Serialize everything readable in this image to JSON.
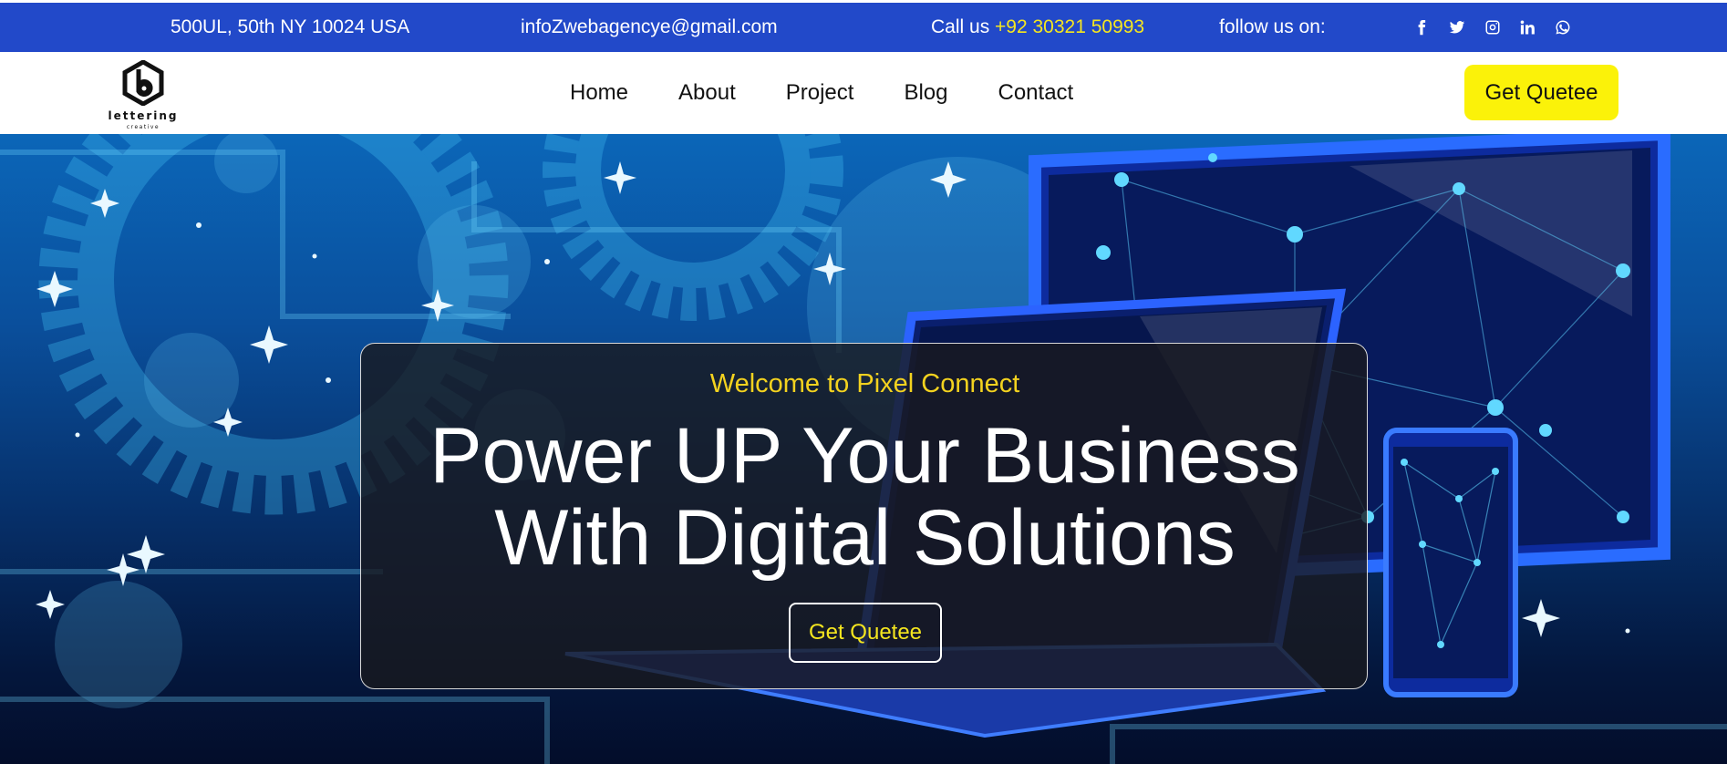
{
  "topbar": {
    "address": "500UL, 50th NY 10024 USA",
    "email": "infoZwebagencye@gmail.com",
    "call_label": "Call us ",
    "phone": "+92 30321 50993",
    "follow_label": "follow us on:",
    "social": [
      "facebook-icon",
      "twitter-icon",
      "instagram-icon",
      "linkedin-icon",
      "whatsapp-icon"
    ],
    "bg_color": "#2249c9",
    "phone_color": "#f5e61f"
  },
  "navbar": {
    "logo": {
      "word": "lettering",
      "sub": "creative",
      "mark": "hexagon-b-icon"
    },
    "links": [
      "Home",
      "About",
      "Project",
      "Blog",
      "Contact"
    ],
    "cta_label": "Get Quetee",
    "cta_color": "#fbf209"
  },
  "hero": {
    "subtitle": "Welcome to Pixel Connect",
    "title_line1": "Power UP Your Business",
    "title_line2": "With Digital Solutions",
    "cta_label": "Get Quetee",
    "subtitle_color": "#f3d21f",
    "cta_text_color": "#f5e61f"
  }
}
